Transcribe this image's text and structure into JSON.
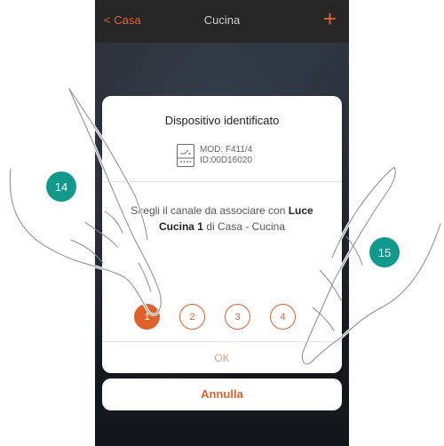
{
  "header": {
    "back_label": "Casa",
    "title": "Cucina",
    "add_icon": "+"
  },
  "dialog": {
    "title": "Dispositivo identificato",
    "device_model": "MOD: F411/4",
    "device_id": "ID:00D16020",
    "prompt_pre": "Scegli il canale da associare con",
    "prompt_load": "Luce Cucina 1",
    "prompt_post": "di Casa - Cucina",
    "channels": [
      "1",
      "2",
      "3",
      "4"
    ],
    "selected_channel": "1",
    "ok_label": "OK"
  },
  "cancel_label": "Annulla",
  "steps": {
    "left": "14",
    "right": "15"
  },
  "colors": {
    "accent": "#e0622a",
    "step_badge": "#11998b"
  }
}
